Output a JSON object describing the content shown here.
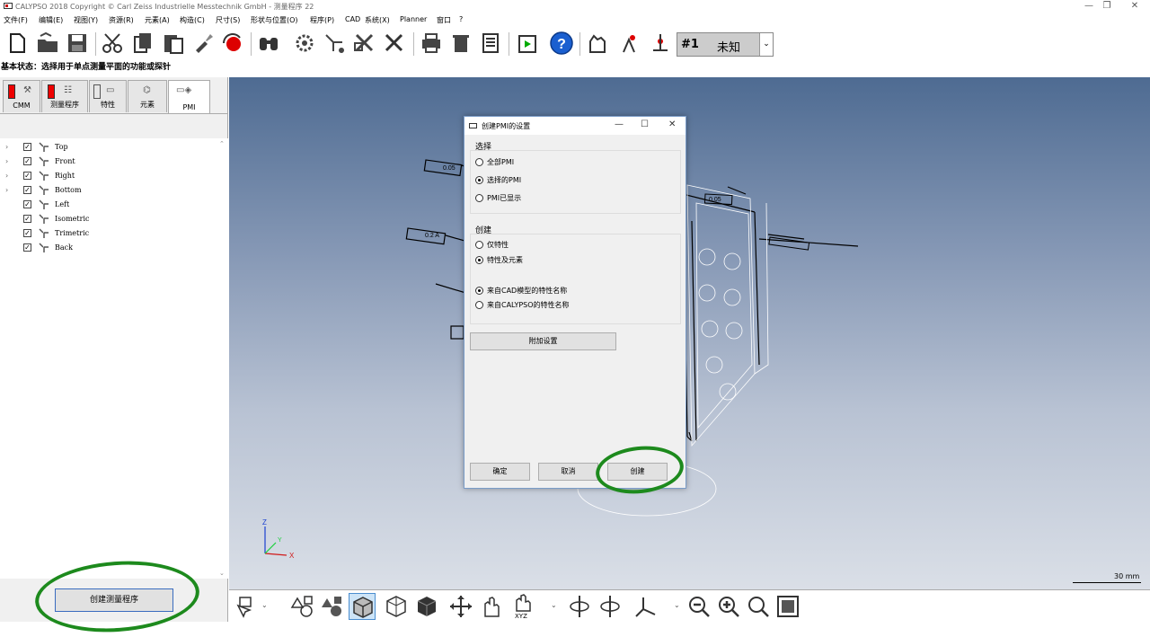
{
  "window": {
    "title": "CALYPSO 2018 Copyright © Carl Zeiss Industrielle Messtechnik GmbH - 测量程序 22",
    "minimize": "—",
    "restore": "❐",
    "close": "✕"
  },
  "menu": [
    "文件(F)",
    "编辑(E)",
    "视图(Y)",
    "资源(R)",
    "元素(A)",
    "构造(C)",
    "尺寸(S)",
    "形状与位置(O)",
    "程序(P)",
    "CAD",
    "系统(X)",
    "Planner",
    "窗口",
    "?"
  ],
  "toolbar": {
    "program_number": "#1",
    "program_value": "未知",
    "dropdown_arrow": "⌄"
  },
  "status_text": "基本状态：选择用于单点测量平面的功能或探针",
  "tabs": [
    {
      "label": "CMM"
    },
    {
      "label": "测量程序"
    },
    {
      "label": "特性"
    },
    {
      "label": "元素"
    },
    {
      "label": "PMI"
    }
  ],
  "tree": [
    {
      "label": "Top",
      "expandable": true
    },
    {
      "label": "Front",
      "expandable": true
    },
    {
      "label": "Right",
      "expandable": true
    },
    {
      "label": "Bottom",
      "expandable": true
    },
    {
      "label": "Left",
      "expandable": false
    },
    {
      "label": "Isometric",
      "expandable": false
    },
    {
      "label": "Trimetric",
      "expandable": false
    },
    {
      "label": "Back",
      "expandable": false
    }
  ],
  "checkmark": "✓",
  "expander": "›",
  "scroll_up": "⌃",
  "scroll_down": "⌄",
  "create_program_button": "创建测量程序",
  "view": {
    "axis_z": "Z",
    "axis_y": "Y",
    "axis_x": "X",
    "scale": "30 mm",
    "pmi_labels": [
      "0.05",
      "0.2 A",
      "0.05"
    ]
  },
  "bottom_toolbar": {
    "xyz_label": "XYZ",
    "dropdown": "⌄"
  },
  "dialog": {
    "title": "创建PMI的设置",
    "min": "—",
    "max": "☐",
    "close": "✕",
    "selection_group": "选择",
    "selection_options": [
      {
        "label": "全部PMI",
        "checked": false
      },
      {
        "label": "选择的PMI",
        "checked": true
      },
      {
        "label": "PMI已显示",
        "checked": false
      }
    ],
    "create_group": "创建",
    "create_options": [
      {
        "label": "仅特性",
        "checked": false
      },
      {
        "label": "特性及元素",
        "checked": true
      }
    ],
    "name_options": [
      {
        "label": "来自CAD模型的特性名称",
        "checked": true
      },
      {
        "label": "来自CALYPSO的特性名称",
        "checked": false
      }
    ],
    "additional_settings": "附加设置",
    "ok": "确定",
    "cancel": "取消",
    "create": "创建"
  },
  "colors": {
    "annotation": "#1d8a1d",
    "view_top": "#4e6b92",
    "view_bottom": "#dadfe7"
  }
}
